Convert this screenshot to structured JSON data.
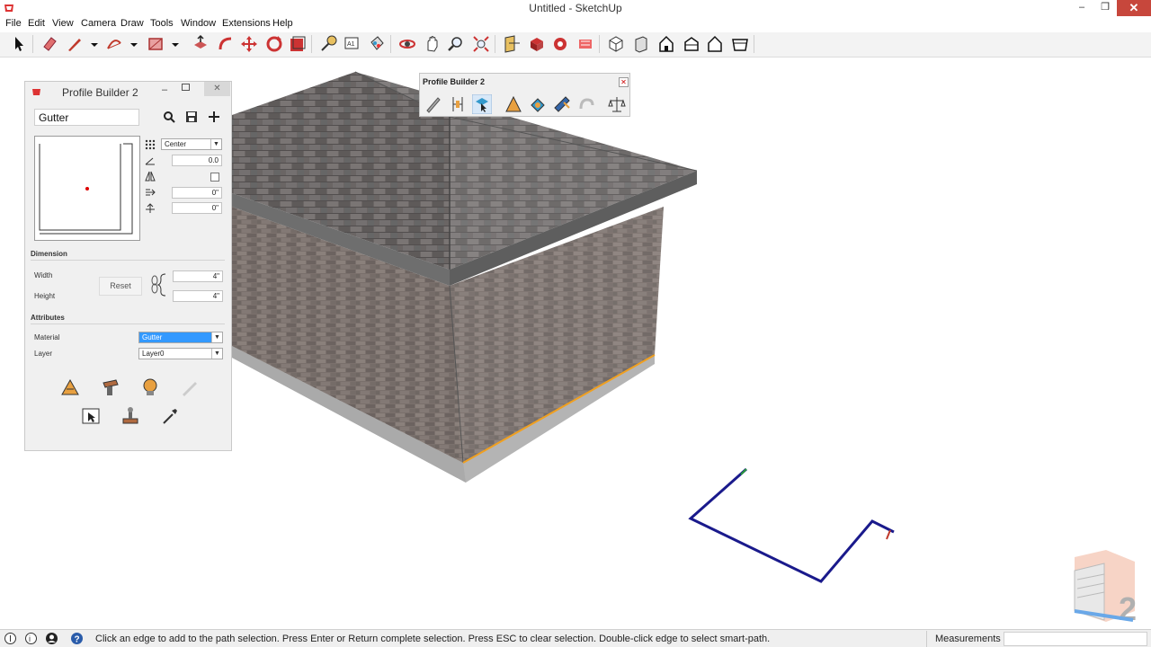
{
  "window": {
    "title": "Untitled - SketchUp",
    "minimize": "–",
    "restore": "❒",
    "close": "✕"
  },
  "menu": [
    "File",
    "Edit",
    "View",
    "Camera",
    "Draw",
    "Tools",
    "Window",
    "Extensions",
    "Help"
  ],
  "toolbar_icons": [
    "select-icon",
    "eraser-icon",
    "pencil-line-icon",
    "dropdown-arrow-icon",
    "arc-icon",
    "dropdown-arrow-icon",
    "rectangle-icon",
    "dropdown-arrow-icon",
    "push-pull-icon",
    "follow-me-icon",
    "move-icon",
    "rotate-icon",
    "scale-icon",
    "tape-measure-icon",
    "text-icon",
    "paint-bucket-icon",
    "orbit-icon",
    "pan-icon",
    "zoom-icon",
    "zoom-extents-icon",
    "section-plane-icon",
    "components-icon",
    "warehouse-icon",
    "extension-warehouse-icon",
    "iso-view-icon",
    "top-view-icon",
    "front-view-icon",
    "right-view-icon",
    "back-view-icon",
    "left-view-icon"
  ],
  "profile_builder": {
    "title": "Profile Builder 2",
    "search_value": "Gutter",
    "alignment": "Center",
    "angle": "0.0",
    "offset_x": "0\"",
    "offset_y": "0\"",
    "dimension_label": "Dimension",
    "width_label": "Width",
    "height_label": "Height",
    "width_value": "4\"",
    "height_value": "4\"",
    "reset_label": "Reset",
    "attributes_label": "Attributes",
    "material_label": "Material",
    "material_value": "Gutter",
    "layer_label": "Layer",
    "layer_value": "Layer0"
  },
  "pb2_toolbar": {
    "title": "Profile Builder 2",
    "close": "✕"
  },
  "status": {
    "text": "Click an edge to add to the path selection. Press Enter or Return complete selection. Press ESC to clear selection. Double-click edge to select smart-path.",
    "measurements_label": "Measurements"
  },
  "colors": {
    "accent": "#3399ff",
    "close_button": "#c7473c",
    "path_line": "#1a1a8c",
    "gutter_edge": "#f0a020"
  }
}
